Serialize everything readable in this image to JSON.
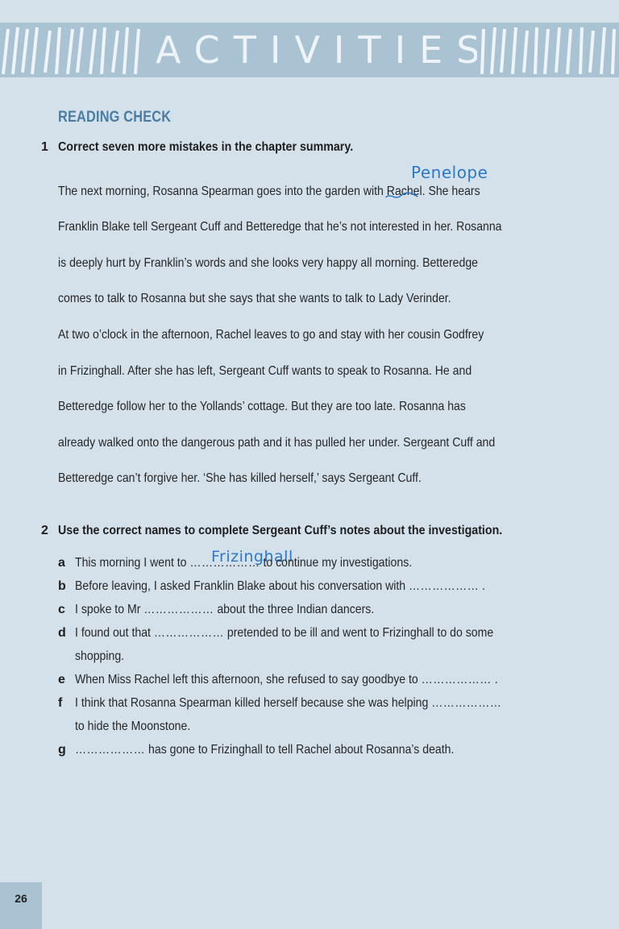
{
  "header": {
    "title": "ACTIVITIES"
  },
  "section": {
    "heading": "READING CHECK"
  },
  "question1": {
    "number": "1",
    "text": "Correct seven more mistakes in the chapter summary.",
    "handwritten_correction": "Penelope",
    "summary_lines": [
      "The next morning, Rosanna Spearman goes into the garden with",
      "Rachel.",
      "She hears",
      "Franklin Blake tell Sergeant Cuff and Betteredge that he’s not interested in her. Rosanna",
      "is deeply hurt by Franklin’s words and she looks very happy all morning. Betteredge",
      "comes to talk to Rosanna but she says that she wants to talk to Lady Verinder.",
      "At two o’clock in the afternoon, Rachel leaves to go and stay with her cousin Godfrey",
      "in Frizinghall. After she has left, Sergeant Cuff wants to speak to Rosanna. He and",
      "Betteredge follow her to the Yollands’ cottage. But they are too late. Rosanna has",
      "already walked onto the dangerous path and it has pulled her under. Sergeant Cuff and",
      "Betteredge can’t forgive her. ‘She has killed herself,’ says Sergeant Cuff."
    ]
  },
  "question2": {
    "number": "2",
    "text": "Use the correct names to complete Sergeant Cuff’s notes about the investigation.",
    "handwritten_answer": "Frizinghall",
    "items": [
      {
        "letter": "a",
        "before": "This morning I went to ",
        "blank": "………………",
        "after": " to continue my investigations."
      },
      {
        "letter": "b",
        "before": "Before leaving, I asked Franklin Blake about his conversation with ",
        "blank": "………………",
        "after": " ."
      },
      {
        "letter": "c",
        "before": "I spoke to Mr ",
        "blank": "………………",
        "after": " about the three Indian dancers."
      },
      {
        "letter": "d",
        "before": "I found out that ",
        "blank": "………………",
        "after": " pretended to be ill and went to Frizinghall to do some",
        "continuation": "shopping."
      },
      {
        "letter": "e",
        "before": "When Miss Rachel left this afternoon, she refused to say goodbye to ",
        "blank": "………………",
        "after": " ."
      },
      {
        "letter": "f",
        "before": "I think that Rosanna Spearman killed herself because she was helping ",
        "blank": "………………",
        "after": "",
        "continuation": "to hide the Moonstone."
      },
      {
        "letter": "g",
        "before": "",
        "blank": "………………",
        "after": " has gone to Frizinghall to tell Rachel about Rosanna’s death."
      }
    ]
  },
  "footer": {
    "page_number": "26"
  },
  "colors": {
    "background": "#d4e1eb",
    "banner": "#a9c3d3",
    "heading": "#4a7da3",
    "handwriting": "#2d78c5"
  }
}
